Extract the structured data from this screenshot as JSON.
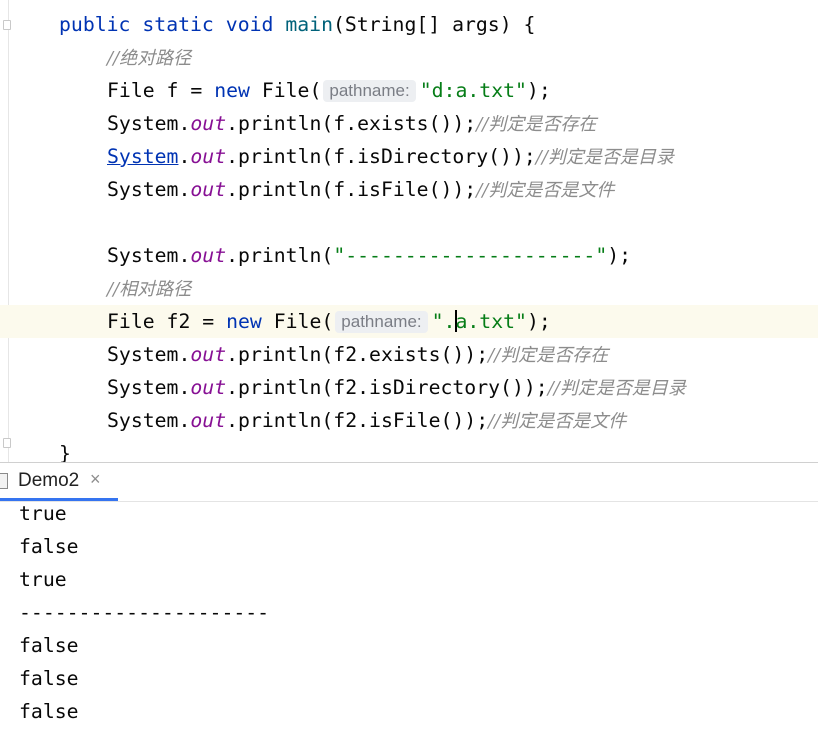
{
  "editor": {
    "lines": [
      {
        "k1": "public",
        "k2": "static",
        "k3": "void",
        "method": "main",
        "params": "(String[] args) {"
      },
      {
        "comment": "//绝对路径"
      },
      {
        "pre": "File f = ",
        "kw": "new",
        "mid": " File(",
        "hint": "pathname:",
        "str": "\"d:a.txt\"",
        "post": ");"
      },
      {
        "cls": "System",
        "dot": ".",
        "field": "out",
        "call": ".println(f.exists());",
        "comment": "//判定是否存在"
      },
      {
        "cls": "System",
        "dot": ".",
        "field": "out",
        "call": ".println(f.isDirectory());",
        "comment": "//判定是否是目录"
      },
      {
        "cls": "System",
        "dot": ".",
        "field": "out",
        "call": ".println(f.isFile());",
        "comment": "//判定是否是文件"
      },
      {
        "cls": "System",
        "dot": ".",
        "field": "out",
        "call": ".println(",
        "str": "\"---------------------\"",
        "post": ");"
      },
      {
        "comment": "//相对路径"
      },
      {
        "pre": "File f2 = ",
        "kw": "new",
        "mid": " File(",
        "hint": "pathname:",
        "str_a": "\".",
        "str_b": "a.txt\"",
        "post": ");"
      },
      {
        "cls": "System",
        "dot": ".",
        "field": "out",
        "call": ".println(f2.exists());",
        "comment": "//判定是否存在"
      },
      {
        "cls": "System",
        "dot": ".",
        "field": "out",
        "call": ".println(f2.isDirectory());",
        "comment": "//判定是否是目录"
      },
      {
        "cls": "System",
        "dot": ".",
        "field": "out",
        "call": ".println(f2.isFile());",
        "comment": "//判定是否是文件"
      },
      {
        "brace": "}"
      }
    ]
  },
  "run_panel": {
    "tab_label": "Demo2",
    "close_glyph": "×",
    "output": [
      "true",
      "false",
      "true",
      "---------------------",
      "false",
      "false",
      "false"
    ]
  }
}
